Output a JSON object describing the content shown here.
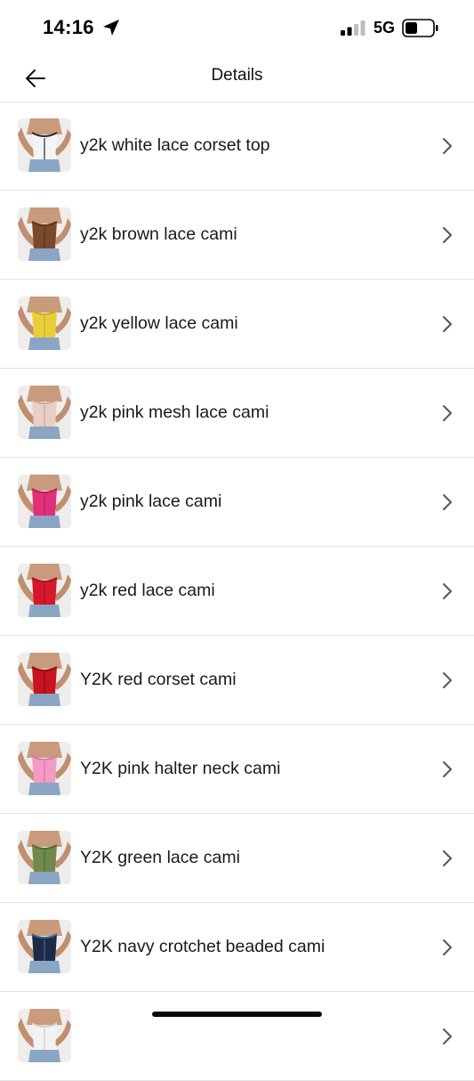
{
  "status_bar": {
    "time": "14:16",
    "network": "5G",
    "icons": [
      "location-arrow-icon",
      "signal-icon",
      "battery-icon"
    ]
  },
  "header": {
    "title": "Details",
    "back_icon": "arrow-left-icon"
  },
  "colors": {
    "background": "#ffffff",
    "divider": "#e3e3e3",
    "text": "#1a1a1a",
    "chevron": "#555555"
  },
  "items": [
    {
      "label": "y2k white lace corset top",
      "top_color": "#f4f4f6",
      "accent": "#2a2a2a"
    },
    {
      "label": "y2k brown lace cami",
      "top_color": "#7a4a2a",
      "accent": "#5a3318"
    },
    {
      "label": "y2k yellow lace cami",
      "top_color": "#e8cf3a",
      "accent": "#c9ad22"
    },
    {
      "label": "y2k pink mesh lace cami",
      "top_color": "#e8cfc6",
      "accent": "#c9a79b"
    },
    {
      "label": "y2k pink lace cami",
      "top_color": "#e0307a",
      "accent": "#b81f5e"
    },
    {
      "label": "y2k red lace cami",
      "top_color": "#d7182a",
      "accent": "#a8101e"
    },
    {
      "label": "Y2K red corset cami",
      "top_color": "#c8141f",
      "accent": "#8f0c14"
    },
    {
      "label": "Y2K pink halter neck cami",
      "top_color": "#f29bc4",
      "accent": "#d97aa8"
    },
    {
      "label": "Y2K green lace cami",
      "top_color": "#6f8a4a",
      "accent": "#546b34"
    },
    {
      "label": "Y2K navy crotchet beaded cami",
      "top_color": "#1f2a48",
      "accent": "#3a6f8c"
    },
    {
      "label": "",
      "top_color": "#f2f2f2",
      "accent": "#cccccc"
    }
  ]
}
